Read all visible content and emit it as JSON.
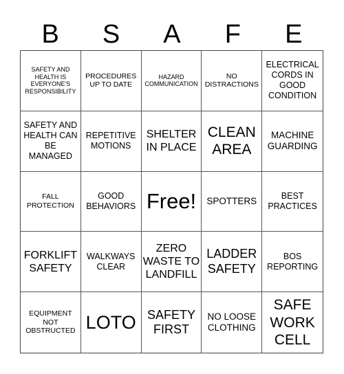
{
  "header": [
    "B",
    "S",
    "A",
    "F",
    "E"
  ],
  "cells": [
    "SAFETY AND HEALTH IS EVERYONE'S RESPONSIBILITY",
    "PROCEDURES UP TO DATE",
    "HAZARD COMMUNICATION",
    "NO DISTRACTIONS",
    "ELECTRICAL CORDS IN GOOD CONDITION",
    "SAFETY AND HEALTH CAN BE MANAGED",
    "REPETITIVE MOTIONS",
    "SHELTER IN PLACE",
    "CLEAN AREA",
    "MACHINE GUARDING",
    "FALL PROTECTION",
    "GOOD BEHAVIORS",
    "Free!",
    "SPOTTERS",
    "BEST PRACTICES",
    "FORKLIFT SAFETY",
    "WALKWAYS CLEAR",
    "ZERO WASTE TO LANDFILL",
    "LADDER SAFETY",
    "BOS REPORTING",
    "EQUIPMENT NOT OBSTRUCTED",
    "LOTO",
    "SAFETY FIRST",
    "NO LOOSE CLOTHING",
    "SAFE WORK CELL"
  ]
}
